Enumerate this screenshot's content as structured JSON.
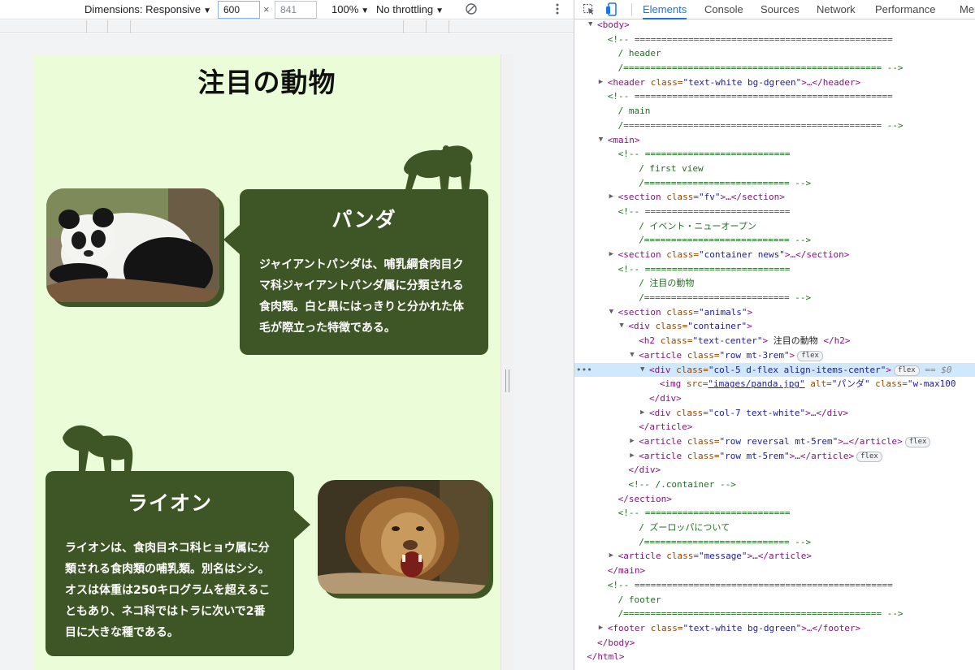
{
  "device_toolbar": {
    "dimensions_label": "Dimensions: Responsive",
    "width": "600",
    "times": "×",
    "height": "841",
    "zoom": "100%",
    "throttling": "No throttling"
  },
  "page": {
    "section_title": "注目の動物",
    "animals": [
      {
        "name": "パンダ",
        "description": "ジャイアントパンダは、哺乳綱食肉目クマ科ジャイアントパンダ属に分類される食肉類。白と黒にはっきりと分かれた体毛が際立った特徴である。"
      },
      {
        "name": "ライオン",
        "description": "ライオンは、食肉目ネコ科ヒョウ属に分類される食肉類の哺乳類。別名はシシ。オスは体重は250キログラムを超えることもあり、ネコ科ではトラに次いで2番目に大きな種である。"
      }
    ]
  },
  "devtools": {
    "tabs": [
      "Elements",
      "Console",
      "Sources",
      "Network",
      "Performance",
      "Mem"
    ],
    "active_tab": "Elements",
    "dom_lines": [
      {
        "indent": 0,
        "tri": "down",
        "parts": [
          [
            "tag",
            "<body>"
          ]
        ]
      },
      {
        "indent": 1,
        "parts": [
          [
            "comment",
            "<!-- ================================================"
          ]
        ]
      },
      {
        "indent": 2,
        "parts": [
          [
            "comment",
            "/ header"
          ]
        ]
      },
      {
        "indent": 2,
        "parts": [
          [
            "comment",
            "/================================================ -->"
          ]
        ]
      },
      {
        "indent": 1,
        "tri": "right",
        "parts": [
          [
            "tag",
            "<header "
          ],
          [
            "attr",
            "class="
          ],
          [
            "val",
            "\"text-white bg-dgreen\""
          ],
          [
            "tag",
            ">…</header>"
          ]
        ]
      },
      {
        "indent": 1,
        "parts": [
          [
            "comment",
            "<!-- ================================================"
          ]
        ]
      },
      {
        "indent": 2,
        "parts": [
          [
            "comment",
            "/ main"
          ]
        ]
      },
      {
        "indent": 2,
        "parts": [
          [
            "comment",
            "/================================================ -->"
          ]
        ]
      },
      {
        "indent": 1,
        "tri": "down",
        "parts": [
          [
            "tag",
            "<main>"
          ]
        ]
      },
      {
        "indent": 2,
        "parts": [
          [
            "comment",
            "<!-- ==========================="
          ]
        ]
      },
      {
        "indent": 4,
        "parts": [
          [
            "comment",
            "/ first view"
          ]
        ]
      },
      {
        "indent": 4,
        "parts": [
          [
            "comment",
            "/=========================== -->"
          ]
        ]
      },
      {
        "indent": 2,
        "tri": "right",
        "parts": [
          [
            "tag",
            "<section "
          ],
          [
            "attr",
            "class="
          ],
          [
            "val",
            "\"fv\""
          ],
          [
            "tag",
            ">…</section>"
          ]
        ]
      },
      {
        "indent": 2,
        "parts": [
          [
            "comment",
            "<!-- ==========================="
          ]
        ]
      },
      {
        "indent": 4,
        "parts": [
          [
            "comment",
            "/ イベント・ニューオープン"
          ]
        ]
      },
      {
        "indent": 4,
        "parts": [
          [
            "comment",
            "/=========================== -->"
          ]
        ]
      },
      {
        "indent": 2,
        "tri": "right",
        "parts": [
          [
            "tag",
            "<section "
          ],
          [
            "attr",
            "class="
          ],
          [
            "val",
            "\"container news\""
          ],
          [
            "tag",
            ">…</section>"
          ]
        ]
      },
      {
        "indent": 2,
        "parts": [
          [
            "comment",
            "<!-- ==========================="
          ]
        ]
      },
      {
        "indent": 4,
        "parts": [
          [
            "comment",
            "/ 注目の動物"
          ]
        ]
      },
      {
        "indent": 4,
        "parts": [
          [
            "comment",
            "/=========================== -->"
          ]
        ]
      },
      {
        "indent": 2,
        "tri": "down",
        "parts": [
          [
            "tag",
            "<section "
          ],
          [
            "attr",
            "class="
          ],
          [
            "val",
            "\"animals\""
          ],
          [
            "tag",
            ">"
          ]
        ]
      },
      {
        "indent": 3,
        "tri": "down",
        "parts": [
          [
            "tag",
            "<div "
          ],
          [
            "attr",
            "class="
          ],
          [
            "val",
            "\"container\""
          ],
          [
            "tag",
            ">"
          ]
        ]
      },
      {
        "indent": 4,
        "parts": [
          [
            "tag",
            "<h2 "
          ],
          [
            "attr",
            "class="
          ],
          [
            "val",
            "\"text-center\""
          ],
          [
            "tag",
            "> "
          ],
          [
            "text",
            "注目の動物"
          ],
          [
            "tag",
            " </h2>"
          ]
        ]
      },
      {
        "indent": 4,
        "tri": "down",
        "parts": [
          [
            "tag",
            "<article "
          ],
          [
            "attr",
            "class="
          ],
          [
            "val",
            "\"row mt-3rem\""
          ],
          [
            "tag",
            ">"
          ],
          [
            "badge",
            "flex"
          ]
        ]
      },
      {
        "indent": 5,
        "tri": "down",
        "selected": true,
        "parts": [
          [
            "tag",
            "<div "
          ],
          [
            "attr",
            "class="
          ],
          [
            "val",
            "\"col-5 d-flex align-items-center\""
          ],
          [
            "tag",
            ">"
          ],
          [
            "badge",
            "flex"
          ],
          [
            "eq",
            " == $0"
          ]
        ]
      },
      {
        "indent": 6,
        "parts": [
          [
            "tag",
            "<img "
          ],
          [
            "attr",
            "src="
          ],
          [
            "link",
            "\"images/panda.jpg\""
          ],
          [
            "attr",
            " alt="
          ],
          [
            "val",
            "\"パンダ\""
          ],
          [
            "attr",
            " class="
          ],
          [
            "val",
            "\"w-max100"
          ]
        ]
      },
      {
        "indent": 5,
        "parts": [
          [
            "tag",
            "</div>"
          ]
        ]
      },
      {
        "indent": 5,
        "tri": "right",
        "parts": [
          [
            "tag",
            "<div "
          ],
          [
            "attr",
            "class="
          ],
          [
            "val",
            "\"col-7 text-white\""
          ],
          [
            "tag",
            ">…</div>"
          ]
        ]
      },
      {
        "indent": 4,
        "parts": [
          [
            "tag",
            "</article>"
          ]
        ]
      },
      {
        "indent": 4,
        "tri": "right",
        "parts": [
          [
            "tag",
            "<article "
          ],
          [
            "attr",
            "class="
          ],
          [
            "val",
            "\"row reversal mt-5rem\""
          ],
          [
            "tag",
            ">…</article>"
          ],
          [
            "badge",
            "flex"
          ]
        ]
      },
      {
        "indent": 4,
        "tri": "right",
        "parts": [
          [
            "tag",
            "<article "
          ],
          [
            "attr",
            "class="
          ],
          [
            "val",
            "\"row mt-5rem\""
          ],
          [
            "tag",
            ">…</article>"
          ],
          [
            "badge",
            "flex"
          ]
        ]
      },
      {
        "indent": 3,
        "parts": [
          [
            "tag",
            "</div>"
          ]
        ]
      },
      {
        "indent": 3,
        "parts": [
          [
            "comment",
            "<!-- /.container -->"
          ]
        ]
      },
      {
        "indent": 2,
        "parts": [
          [
            "tag",
            "</section>"
          ]
        ]
      },
      {
        "indent": 2,
        "parts": [
          [
            "comment",
            "<!-- ==========================="
          ]
        ]
      },
      {
        "indent": 4,
        "parts": [
          [
            "comment",
            "/ ズーロッパについて"
          ]
        ]
      },
      {
        "indent": 4,
        "parts": [
          [
            "comment",
            "/=========================== -->"
          ]
        ]
      },
      {
        "indent": 2,
        "tri": "right",
        "parts": [
          [
            "tag",
            "<article "
          ],
          [
            "attr",
            "class="
          ],
          [
            "val",
            "\"message\""
          ],
          [
            "tag",
            ">…</article>"
          ]
        ]
      },
      {
        "indent": 1,
        "parts": [
          [
            "tag",
            "</main>"
          ]
        ]
      },
      {
        "indent": 1,
        "parts": [
          [
            "comment",
            "<!-- ================================================"
          ]
        ]
      },
      {
        "indent": 2,
        "parts": [
          [
            "comment",
            "/ footer"
          ]
        ]
      },
      {
        "indent": 2,
        "parts": [
          [
            "comment",
            "/================================================ -->"
          ]
        ]
      },
      {
        "indent": 1,
        "tri": "right",
        "parts": [
          [
            "tag",
            "<footer "
          ],
          [
            "attr",
            "class="
          ],
          [
            "val",
            "\"text-white bg-dgreen\""
          ],
          [
            "tag",
            ">…</footer>"
          ]
        ]
      },
      {
        "indent": 0,
        "parts": [
          [
            "tag",
            "</body>"
          ]
        ]
      },
      {
        "indent": -1,
        "parts": [
          [
            "tag",
            "</html>"
          ]
        ]
      }
    ]
  },
  "colors": {
    "page_bg": "#eafdd8",
    "accent_green": "#3e5526",
    "devtools_active": "#1a73e8"
  }
}
